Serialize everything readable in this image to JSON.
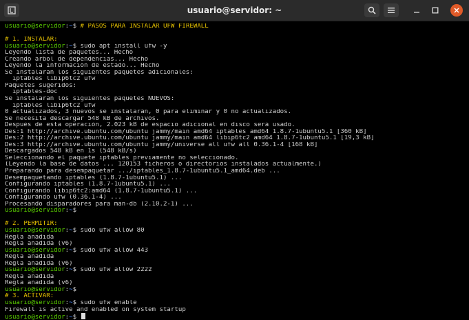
{
  "window": {
    "title": "usuario@servidor: ~"
  },
  "prompt": {
    "user_host": "usuario@servidor",
    "path": "~",
    "symbol": "$"
  },
  "lines": [
    {
      "type": "prompt",
      "cmd": "# PASOS PARA INSTALAR UFW FIREWALL"
    },
    {
      "type": "blank",
      "text": ""
    },
    {
      "type": "comment",
      "text": "# 1. INSTALAR:"
    },
    {
      "type": "prompt",
      "cmd": "sudo apt install ufw -y"
    },
    {
      "type": "out",
      "text": "Leyendo lista de paquetes... Hecho"
    },
    {
      "type": "out",
      "text": "Creando árbol de dependencias... Hecho"
    },
    {
      "type": "out",
      "text": "Leyendo la información de estado... Hecho"
    },
    {
      "type": "out",
      "text": "Se instalarán los siguientes paquetes adicionales:"
    },
    {
      "type": "out",
      "text": "  iptables libip6tc2 ufw"
    },
    {
      "type": "out",
      "text": "Paquetes sugeridos:"
    },
    {
      "type": "out",
      "text": "  iptables-doc"
    },
    {
      "type": "out",
      "text": "Se instalarán los siguientes paquetes NUEVOS:"
    },
    {
      "type": "out",
      "text": "  iptables libip6tc2 ufw"
    },
    {
      "type": "out",
      "text": "0 actualizados, 3 nuevos se instalarán, 0 para eliminar y 0 no actualizados."
    },
    {
      "type": "out",
      "text": "Se necesita descargar 548 kB de archivos."
    },
    {
      "type": "out",
      "text": "Después de esta operación, 2.023 kB de espacio adicional en disco será usado."
    },
    {
      "type": "out",
      "text": "Des:1 http://archive.ubuntu.com/ubuntu jammy/main amd64 iptables amd64 1.8.7-1ubuntu5.1 [360 kB]"
    },
    {
      "type": "out",
      "text": "Des:2 http://archive.ubuntu.com/ubuntu jammy/main amd64 libip6tc2 amd64 1.8.7-1ubuntu5.1 [19,3 kB]"
    },
    {
      "type": "out",
      "text": "Des:3 http://archive.ubuntu.com/ubuntu jammy/universe all ufw all 0.36.1-4 [168 kB]"
    },
    {
      "type": "out",
      "text": "Descargados 548 kB en 1s (548 kB/s)"
    },
    {
      "type": "out",
      "text": "Seleccionando el paquete iptables previamente no seleccionado."
    },
    {
      "type": "out",
      "text": "(Leyendo la base de datos ... 120153 ficheros o directorios instalados actualmente.)"
    },
    {
      "type": "out",
      "text": "Preparando para desempaquetar .../iptables_1.8.7-1ubuntu5.1_amd64.deb ..."
    },
    {
      "type": "out",
      "text": "Desempaquetando iptables (1.8.7-1ubuntu5.1) ..."
    },
    {
      "type": "out",
      "text": "Configurando iptables (1.8.7-1ubuntu5.1) ..."
    },
    {
      "type": "out",
      "text": "Configurando libip6tc2:amd64 (1.8.7-1ubuntu5.1) ..."
    },
    {
      "type": "out",
      "text": "Configurando ufw (0.36.1-4) ..."
    },
    {
      "type": "out",
      "text": "Procesando disparadores para man-db (2.10.2-1) ..."
    },
    {
      "type": "prompt",
      "cmd": ""
    },
    {
      "type": "blank",
      "text": ""
    },
    {
      "type": "comment",
      "text": "# 2. PERMITIR:"
    },
    {
      "type": "prompt",
      "cmd": "sudo ufw allow 80"
    },
    {
      "type": "out",
      "text": "Regla añadida"
    },
    {
      "type": "out",
      "text": "Regla añadida (v6)"
    },
    {
      "type": "prompt",
      "cmd": "sudo ufw allow 443"
    },
    {
      "type": "out",
      "text": "Regla añadida"
    },
    {
      "type": "out",
      "text": "Regla añadida (v6)"
    },
    {
      "type": "prompt",
      "cmd": "sudo ufw allow 2222"
    },
    {
      "type": "out",
      "text": "Regla añadida"
    },
    {
      "type": "out",
      "text": "Regla añadida (v6)"
    },
    {
      "type": "prompt",
      "cmd": ""
    },
    {
      "type": "comment",
      "text": "# 3. ACTIVAR:"
    },
    {
      "type": "prompt",
      "cmd": "sudo ufw enable"
    },
    {
      "type": "out",
      "text": "Firewall is active and enabled on system startup"
    },
    {
      "type": "prompt",
      "cmd": "",
      "cursor": true
    }
  ],
  "colors": {
    "user_host": "#5dd400",
    "path": "#4a8cff",
    "comment": "#e8c300",
    "output": "#d0d0d0",
    "close_button": "#e05a28",
    "titlebar": "#2b2b2b"
  },
  "icons": {
    "new_tab": "new-tab-icon",
    "search": "search-icon",
    "menu": "hamburger-menu-icon",
    "minimize": "minimize-icon",
    "maximize": "maximize-icon",
    "close": "close-icon"
  }
}
